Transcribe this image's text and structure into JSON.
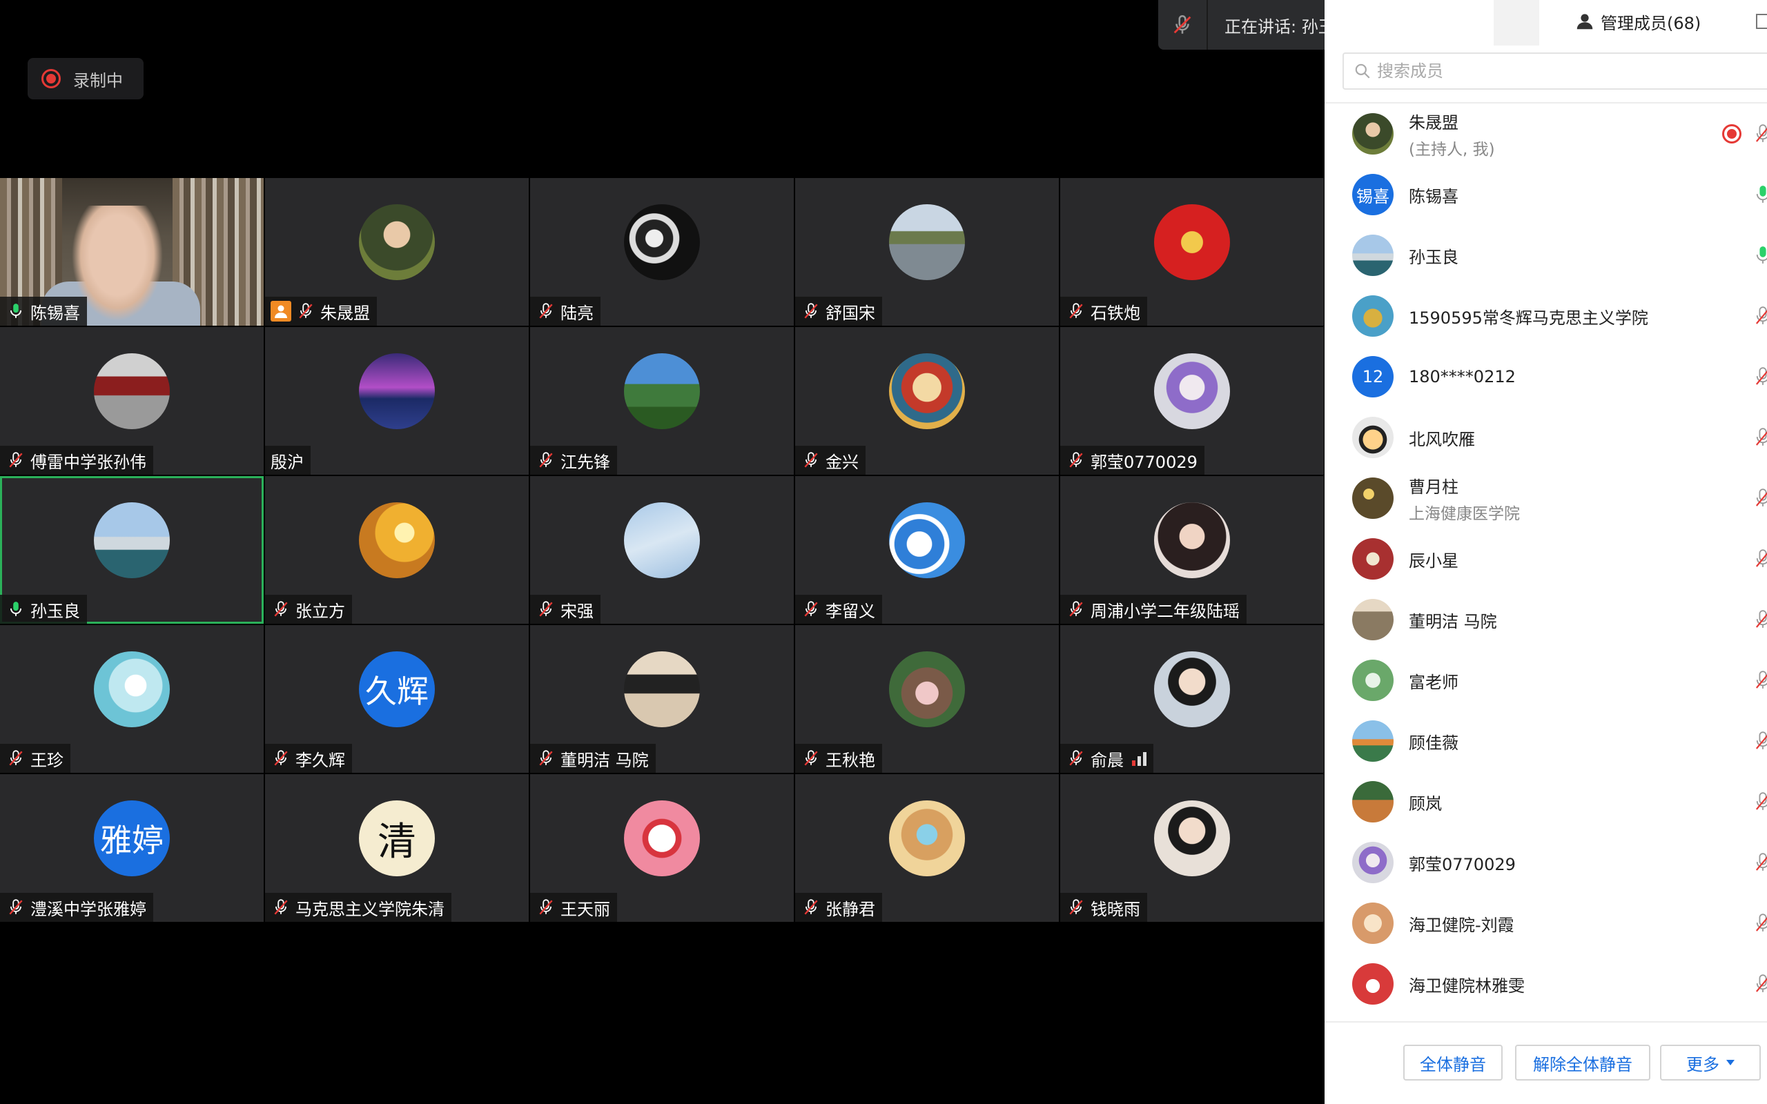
{
  "recording": {
    "label": "录制中"
  },
  "speaking_banner": {
    "text": "正在讲话: 孙玉良; 陈锡喜;"
  },
  "colors": {
    "accent": "#1a6fe0",
    "active_speaker_border": "#2bb15a",
    "recording_red": "#e53935",
    "tile_bg": "#29292b"
  },
  "tiles": [
    {
      "name": "陈锡喜",
      "mic": "on",
      "avatar": "video",
      "avatar_bg": ""
    },
    {
      "name": "朱晟盟",
      "mic": "muted",
      "host": true,
      "avatar": "photo",
      "avatar_bg": "radial-gradient(circle at 50% 40%, #e9c9a8 0 22%, #3b4a2a 23% 60%, #6d7d3a 61%)"
    },
    {
      "name": "陆亮",
      "mic": "muted",
      "avatar": "photo",
      "avatar_bg": "radial-gradient(circle at 40% 45%, #eee 0 14%, #222 15% 30%, #ddd 31% 40%, #111 41%)"
    },
    {
      "name": "舒国宋",
      "mic": "muted",
      "avatar": "photo",
      "avatar_bg": "linear-gradient(180deg,#c9d6e3 0 35%, #6b7a4c 36% 52%, #7f8a92 53%)"
    },
    {
      "name": "石铁炮",
      "mic": "muted",
      "avatar": "photo",
      "avatar_bg": "radial-gradient(circle at 50% 50%, #f2c94c 0 20%, #d62020 21%)"
    },
    {
      "name": "傅雷中学张孙伟",
      "mic": "muted",
      "avatar": "photo",
      "avatar_bg": "linear-gradient(180deg,#d0d0d0 0 30%, #8b1e1e 31% 55%, #9a9a9a 56%)"
    },
    {
      "name": "殷沪",
      "mic": "none",
      "avatar": "photo",
      "avatar_bg": "linear-gradient(180deg,#3a2b78 0%, #b24ec7 45%, #1b2a66 60%, #2f3f8c 100%)"
    },
    {
      "name": "江先锋",
      "mic": "muted",
      "avatar": "photo",
      "avatar_bg": "linear-gradient(180deg,#4d8fd6 0 40%, #3f7a3c 41% 70%, #2a5a22 71%)"
    },
    {
      "name": "金兴",
      "mic": "muted",
      "avatar": "photo",
      "avatar_bg": "radial-gradient(circle at 50% 45%, #f3d9a4 0 25%, #c43a2a 26% 45%, #2f6a8a 46% 62%, #e2b04a 63%)"
    },
    {
      "name": "郭莹0770029",
      "mic": "muted",
      "avatar": "photo",
      "avatar_bg": "radial-gradient(circle at 50% 45%, #f0e9ef 0 22%, #8e6cc9 23% 45%, #d8d8e0 46%)"
    },
    {
      "name": "孙玉良",
      "mic": "on",
      "active": true,
      "avatar": "photo",
      "avatar_bg": "linear-gradient(180deg,#a7c8e8 0 45%, #cfd8de 46% 62%, #2a6470 63%)"
    },
    {
      "name": "张立方",
      "mic": "muted",
      "avatar": "photo",
      "avatar_bg": "radial-gradient(circle at 60% 40%, #fff2b0 0 15%, #f0b030 16% 45%, #c87a20 46%)"
    },
    {
      "name": "宋强",
      "mic": "muted",
      "avatar": "photo",
      "avatar_bg": "linear-gradient(160deg,#a9c9e8 0%, #d9e7f3 50%, #9dbfe0 100%)"
    },
    {
      "name": "李留义",
      "mic": "muted",
      "avatar": "photo",
      "avatar_bg": "radial-gradient(circle at 40% 55%, #fff 0 20%, #2f7fd8 21% 40%, #ffffff 41% 48%, #3a8de0 49%)"
    },
    {
      "name": "周浦小学二年级陆瑶",
      "mic": "muted",
      "avatar": "photo",
      "avatar_bg": "radial-gradient(circle at 50% 45%, #f0d4c4 0 22%, #2a1f1f 23% 60%, #e6dcd8 61%)"
    },
    {
      "name": "王珍",
      "mic": "muted",
      "avatar": "photo",
      "avatar_bg": "radial-gradient(circle at 55% 45%, #ffffff 0 18%, #bfe8f0 19% 45%, #6dc4d6 46%)"
    },
    {
      "name": "李久辉",
      "mic": "muted",
      "avatar": "text",
      "avatar_text": "久辉",
      "avatar_bg": "#1a6fe0"
    },
    {
      "name": "董明洁 马院",
      "mic": "muted",
      "avatar": "photo",
      "avatar_bg": "linear-gradient(180deg,#e6d8c4 0 30%, #222 31% 55%, #d9c8b0 56%)"
    },
    {
      "name": "王秋艳",
      "mic": "muted",
      "avatar": "photo",
      "avatar_bg": "radial-gradient(circle at 50% 55%, #f0c8c8 0 20%, #7a5a48 21% 45%, #3f6a3a 46%)"
    },
    {
      "name": "俞晨",
      "mic": "muted",
      "signal": true,
      "avatar": "photo",
      "avatar_bg": "radial-gradient(circle at 50% 40%, #f2dccb 0 22%, #1b1b1b 23% 40%, #c9d2dc 41%)"
    },
    {
      "name": "澧溪中学张雅婷",
      "mic": "muted",
      "avatar": "text",
      "avatar_text": "雅婷",
      "avatar_bg": "#1a6fe0"
    },
    {
      "name": "马克思主义学院朱清",
      "mic": "muted",
      "avatar": "text-dark",
      "avatar_text": "清",
      "avatar_bg": "#f5ecd0"
    },
    {
      "name": "王天丽",
      "mic": "muted",
      "avatar": "photo",
      "avatar_bg": "radial-gradient(circle at 50% 50%, #ffffff 0 25%, #d8343e 26% 36%, #f08aa0 37%)"
    },
    {
      "name": "张静君",
      "mic": "muted",
      "avatar": "photo",
      "avatar_bg": "radial-gradient(circle at 50% 45%, #8ad0e8 0 18%, #d8a060 19% 45%, #f0d49a 46%)"
    },
    {
      "name": "钱晓雨",
      "mic": "muted",
      "avatar": "photo",
      "avatar_bg": "radial-gradient(circle at 50% 40%, #f2dccb 0 22%, #1b1b1b 23% 40%, #e8e0d8 41%)"
    }
  ],
  "sidebar": {
    "tab_label": "管理成员(68)",
    "search_placeholder": "搜索成员",
    "members": [
      {
        "name": "朱晟盟",
        "sub": "(主持人, 我)",
        "recording": true,
        "mic": "muted",
        "avatar_bg": "radial-gradient(circle at 50% 40%, #e9c9a8 0 22%, #3b4a2a 23% 60%, #6d7d3a 61%)"
      },
      {
        "name": "陈锡喜",
        "avatar_text": "锡喜",
        "mic": "on",
        "avatar_bg": "#1a6fe0"
      },
      {
        "name": "孙玉良",
        "mic": "on",
        "avatar_bg": "linear-gradient(180deg,#a7c8e8 0 45%, #cfd8de 46% 62%, #2a6470 63%)"
      },
      {
        "name": "1590595常冬辉马克思主义学院",
        "mic": "muted",
        "avatar_bg": "radial-gradient(circle at 50% 55%, #d8b040 0 30%, #4aa0c8 31%)"
      },
      {
        "name": "180****0212",
        "avatar_text": "12",
        "mic": "muted",
        "avatar_bg": "#1a6fe0"
      },
      {
        "name": "北风吹雁",
        "mic": "muted",
        "avatar_bg": "radial-gradient(circle at 50% 55%, #ffd28a 0 32%, #222 33% 45%, #e8e8e8 46%)"
      },
      {
        "name": "曹月柱",
        "sub": "上海健康医学院",
        "mic": "muted",
        "avatar_bg": "radial-gradient(circle at 40% 40%, #f3d26a 0 15%, #5a4a2a 16%)"
      },
      {
        "name": "辰小星",
        "mic": "muted",
        "avatar_bg": "radial-gradient(circle at 50% 50%, #f0e6d0 0 22%, #a83030 23%)"
      },
      {
        "name": "董明洁 马院",
        "mic": "muted",
        "avatar_bg": "linear-gradient(180deg,#e6d8c4 0 30%, #8a7a62 31%)"
      },
      {
        "name": "富老师",
        "mic": "muted",
        "avatar_bg": "radial-gradient(circle at 50% 50%, #e8f3e8 0 25%, #6aa86a 26%)"
      },
      {
        "name": "顾佳薇",
        "mic": "muted",
        "avatar_bg": "linear-gradient(180deg,#8ac0e8 0 45%, #e08a3a 46% 60%, #3a7a4a 61%)"
      },
      {
        "name": "顾岚",
        "mic": "muted",
        "avatar_bg": "linear-gradient(180deg,#3a6a3a 0 45%, #c87a3a 46%)"
      },
      {
        "name": "郭莹0770029",
        "mic": "muted",
        "avatar_bg": "radial-gradient(circle at 50% 45%, #f0e9ef 0 22%, #8e6cc9 23% 45%, #d8d8e0 46%)"
      },
      {
        "name": "海卫健院-刘霞",
        "mic": "muted",
        "avatar_bg": "radial-gradient(circle at 50% 50%, #f8e4c8 0 30%, #d89a6a 31%)"
      },
      {
        "name": "海卫健院林雅雯",
        "mic": "muted",
        "avatar_bg": "radial-gradient(circle at 50% 55%, #ffffff 0 22%, #d83a3a 23%)"
      }
    ],
    "footer_buttons": {
      "mute_all": "全体静音",
      "unmute_all": "解除全体静音",
      "more": "更多"
    }
  }
}
